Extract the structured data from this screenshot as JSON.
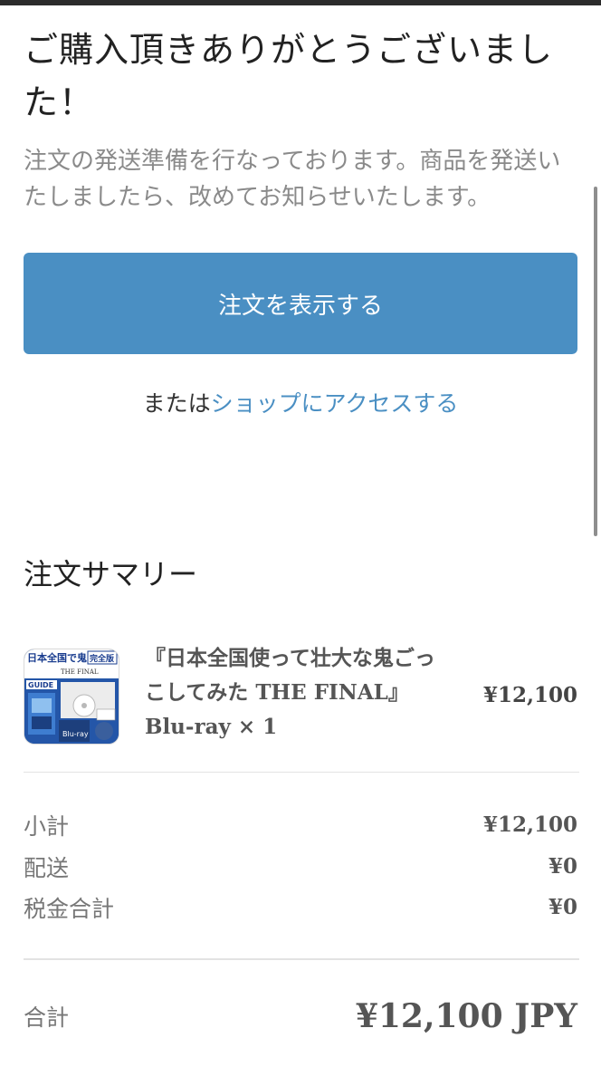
{
  "confirmation": {
    "title": "ご購入頂きありがとうございました！",
    "message": "注文の発送準備を行なっております。商品を発送いたしましたら、改めてお知らせいたします。",
    "view_order_label": "注文を表示する",
    "shop_prefix": "または",
    "shop_link_label": "ショップにアクセスする"
  },
  "summary": {
    "title": "注文サマリー",
    "items": [
      {
        "name": "『日本全国使って壮大な鬼ごっこしてみた THE FINAL』Blu-ray × 1",
        "price": "¥12,100",
        "thumbnail": {
          "title_text": "日本全国で鬼ごっこ",
          "badge_text": "完全版",
          "subtitle_text": "THE FINAL",
          "guide_text": "GUIDE",
          "format_text": "Blu-ray"
        }
      }
    ],
    "lines": [
      {
        "label": "小計",
        "value": "¥12,100"
      },
      {
        "label": "配送",
        "value": "¥0"
      },
      {
        "label": "税金合計",
        "value": "¥0"
      }
    ],
    "total_label": "合計",
    "total_value": "¥12,100 JPY"
  },
  "colors": {
    "accent": "#4a8fc3",
    "text": "#333333",
    "muted": "#8a8a8a"
  }
}
